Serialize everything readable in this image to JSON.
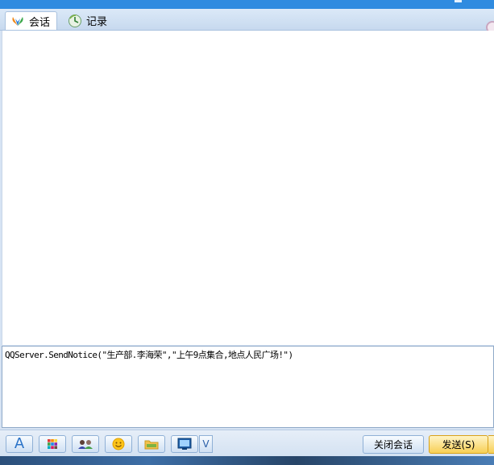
{
  "tabs": [
    {
      "label": "会话",
      "icon": "butterfly-icon",
      "active": true
    },
    {
      "label": "记录",
      "icon": "history-icon",
      "active": false
    }
  ],
  "chat": {
    "messages": []
  },
  "input": {
    "text": "QQServer.SendNotice(\"生产部.李海荣\",\"上午9点集合,地点人民广场!\")"
  },
  "toolbar": {
    "font_label": "A",
    "more_label": "V",
    "close_label": "关闭会话",
    "send_label": "发送(S)"
  },
  "colors": {
    "title_bar": "#2f8be0",
    "send_button": "#f7cf55",
    "accent": "#2a73c8"
  }
}
